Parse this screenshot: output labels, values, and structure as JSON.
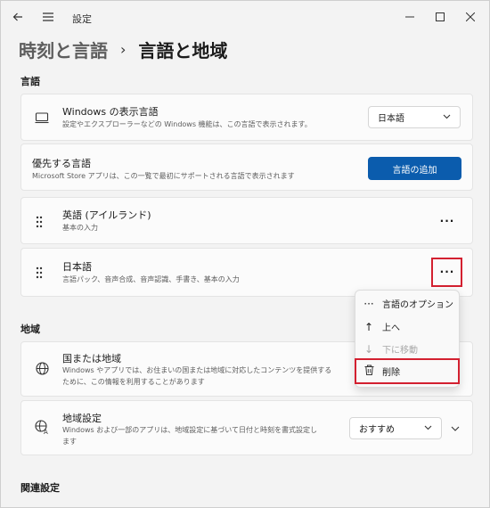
{
  "window": {
    "title": "設定",
    "back_icon": "back-arrow-icon",
    "menu_icon": "hamburger-icon",
    "minimize_glyph": "—",
    "maximize_glyph": "☐",
    "close_glyph": "✕"
  },
  "breadcrumb": {
    "parent": "時刻と言語",
    "separator": "›",
    "current": "言語と地域"
  },
  "language_section": {
    "title": "言語",
    "display_language": {
      "title": "Windows の表示言語",
      "subtitle": "設定やエクスプローラーなどの Windows 機能は、この言語で表示されます。",
      "icon": "monitor-icon",
      "dropdown_value": "日本語"
    },
    "preferred": {
      "title": "優先する言語",
      "subtitle": "Microsoft Store アプリは、この一覧で最初にサポートされる言語で表示されます",
      "button": "言語の追加"
    },
    "languages": [
      {
        "name": "英語 (アイルランド)",
        "detail": "基本の入力"
      },
      {
        "name": "日本語",
        "detail": "言語パック、音声合成、音声認識、手書き、基本の入力"
      }
    ],
    "more_glyph": "···"
  },
  "context_menu": {
    "items": [
      {
        "label": "言語のオプション",
        "icon": "more-icon",
        "glyph": "···",
        "disabled": false
      },
      {
        "label": "上へ",
        "icon": "arrow-up-icon",
        "glyph": "↑",
        "disabled": false
      },
      {
        "label": "下に移動",
        "icon": "arrow-down-icon",
        "glyph": "↓",
        "disabled": true
      },
      {
        "label": "削除",
        "icon": "trash-icon",
        "glyph": "🗑",
        "disabled": false
      }
    ]
  },
  "region_section": {
    "title": "地域",
    "country": {
      "title": "国または地域",
      "subtitle_line1": "Windows やアプリでは、お住まいの国または地域に対応したコンテンツを提供する",
      "subtitle_line2": "ために、この情報を利用することがあります",
      "icon": "globe-icon"
    },
    "format": {
      "title": "地域設定",
      "subtitle_line1": "Windows および一部のアプリは、地域設定に基づいて日付と時刻を書式設定し",
      "subtitle_line2": "ます",
      "icon": "region-format-icon",
      "dropdown_value": "おすすめ",
      "expand_glyph": "⌄"
    }
  },
  "related_section": {
    "title": "関連設定"
  },
  "colors": {
    "accent": "#0b5cad",
    "highlight": "#d32030"
  }
}
